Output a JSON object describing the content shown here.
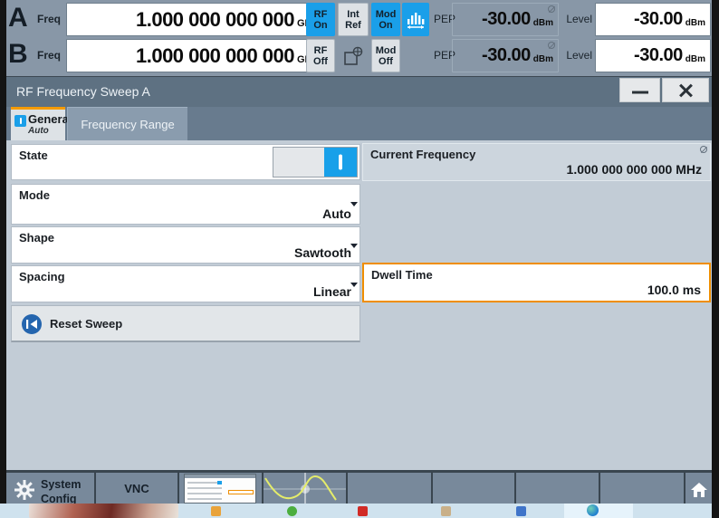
{
  "window": {
    "title": "RF Frequency Sweep A"
  },
  "header": {
    "row_a": {
      "channel": "A",
      "freq_label": "Freq",
      "freq_value": "1.000 000 000 000",
      "freq_unit": "GHz",
      "rf_line1": "RF",
      "rf_line2": "On",
      "ref_line1": "Int",
      "ref_line2": "Ref",
      "mod_line1": "Mod",
      "mod_line2": "On",
      "pep_label": "PEP",
      "pep_value": "-30.00",
      "pep_unit": "dBm",
      "level_label": "Level",
      "level_value": "-30.00",
      "level_unit": "dBm"
    },
    "row_b": {
      "channel": "B",
      "freq_label": "Freq",
      "freq_value": "1.000 000 000 000",
      "freq_unit": "GHz",
      "rf_line1": "RF",
      "rf_line2": "Off",
      "mod_line1": "Mod",
      "mod_line2": "Off",
      "pep_label": "PEP",
      "pep_value": "-30.00",
      "pep_unit": "dBm",
      "level_label": "Level",
      "level_value": "-30.00",
      "level_unit": "dBm"
    }
  },
  "tabs": {
    "general": {
      "label": "General",
      "sub": "Auto",
      "active": true
    },
    "frequency_range": {
      "label": "Frequency Range",
      "active": false
    }
  },
  "panel": {
    "state": {
      "label": "State",
      "on": true
    },
    "mode": {
      "label": "Mode",
      "value": "Auto"
    },
    "shape": {
      "label": "Shape",
      "value": "Sawtooth"
    },
    "spacing": {
      "label": "Spacing",
      "value": "Linear"
    },
    "reset_sweep": {
      "label": "Reset Sweep"
    },
    "current_frequency": {
      "label": "Current Frequency",
      "value": "1.000 000 000 000 MHz",
      "protected": true
    },
    "dwell_time": {
      "label": "Dwell Time",
      "value": "100.0 ms",
      "focused": true
    }
  },
  "taskbar": {
    "system_config": "System Config",
    "vnc": "VNC"
  },
  "colors": {
    "accent_blue": "#18a0e9",
    "accent_orange": "#ef8e00",
    "tab_orange": "#f59b00",
    "header_bg": "#8897a7",
    "titlebar_bg": "#5e7182",
    "content_bg": "#c2ccd6",
    "taskbar_cell_bg": "#78899b"
  }
}
